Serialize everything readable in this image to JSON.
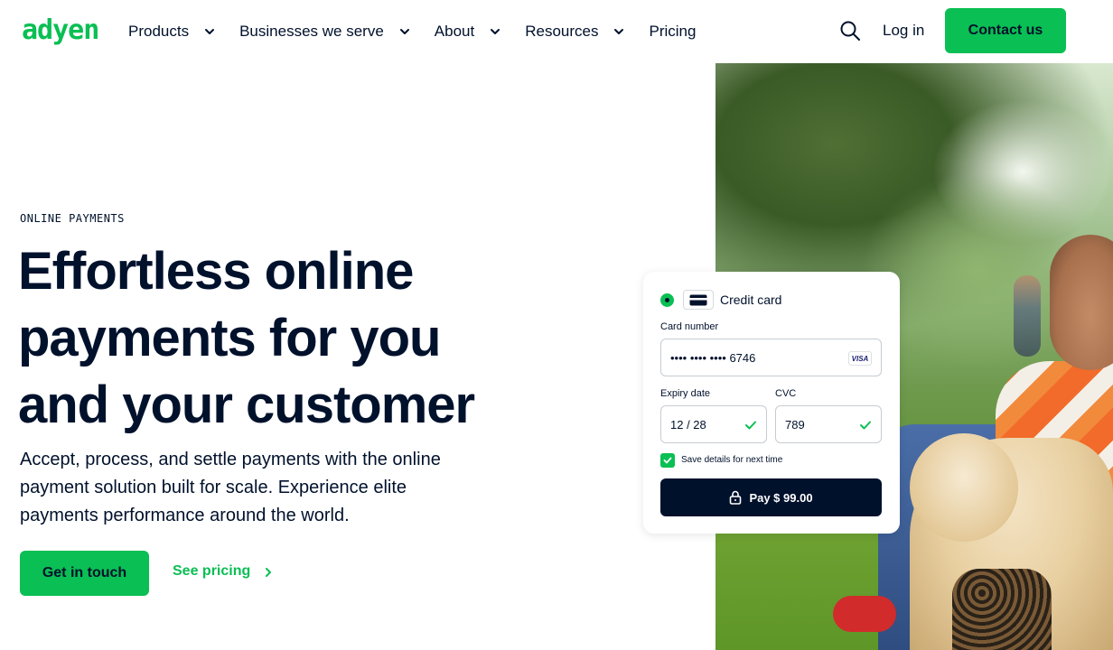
{
  "brand": {
    "logo_text": "adyen",
    "accent_color": "#0abf53",
    "text_color": "#00112c"
  },
  "nav": {
    "items": [
      {
        "label": "Products",
        "has_dropdown": true
      },
      {
        "label": "Businesses we serve",
        "has_dropdown": true
      },
      {
        "label": "About",
        "has_dropdown": true
      },
      {
        "label": "Resources",
        "has_dropdown": true
      },
      {
        "label": "Pricing",
        "has_dropdown": false
      }
    ],
    "search_icon": "search-icon",
    "login_label": "Log in",
    "contact_label": "Contact us"
  },
  "hero": {
    "eyebrow": "ONLINE PAYMENTS",
    "headline": "Effortless online payments for you and your customer",
    "subtext": "Accept, process, and settle payments with the online payment solution built for scale. Experience elite payments performance around the world.",
    "primary_cta": "Get in touch",
    "secondary_cta": "See pricing"
  },
  "payment_card": {
    "method_label": "Credit card",
    "card_number_label": "Card number",
    "card_number_value": "•••• •••• •••• 6746",
    "card_brand": "VISA",
    "expiry_label": "Expiry date",
    "expiry_value": "12 / 28",
    "cvc_label": "CVC",
    "cvc_value": "789",
    "save_label": "Save details for next time",
    "pay_label": "Pay $ 99.00"
  }
}
